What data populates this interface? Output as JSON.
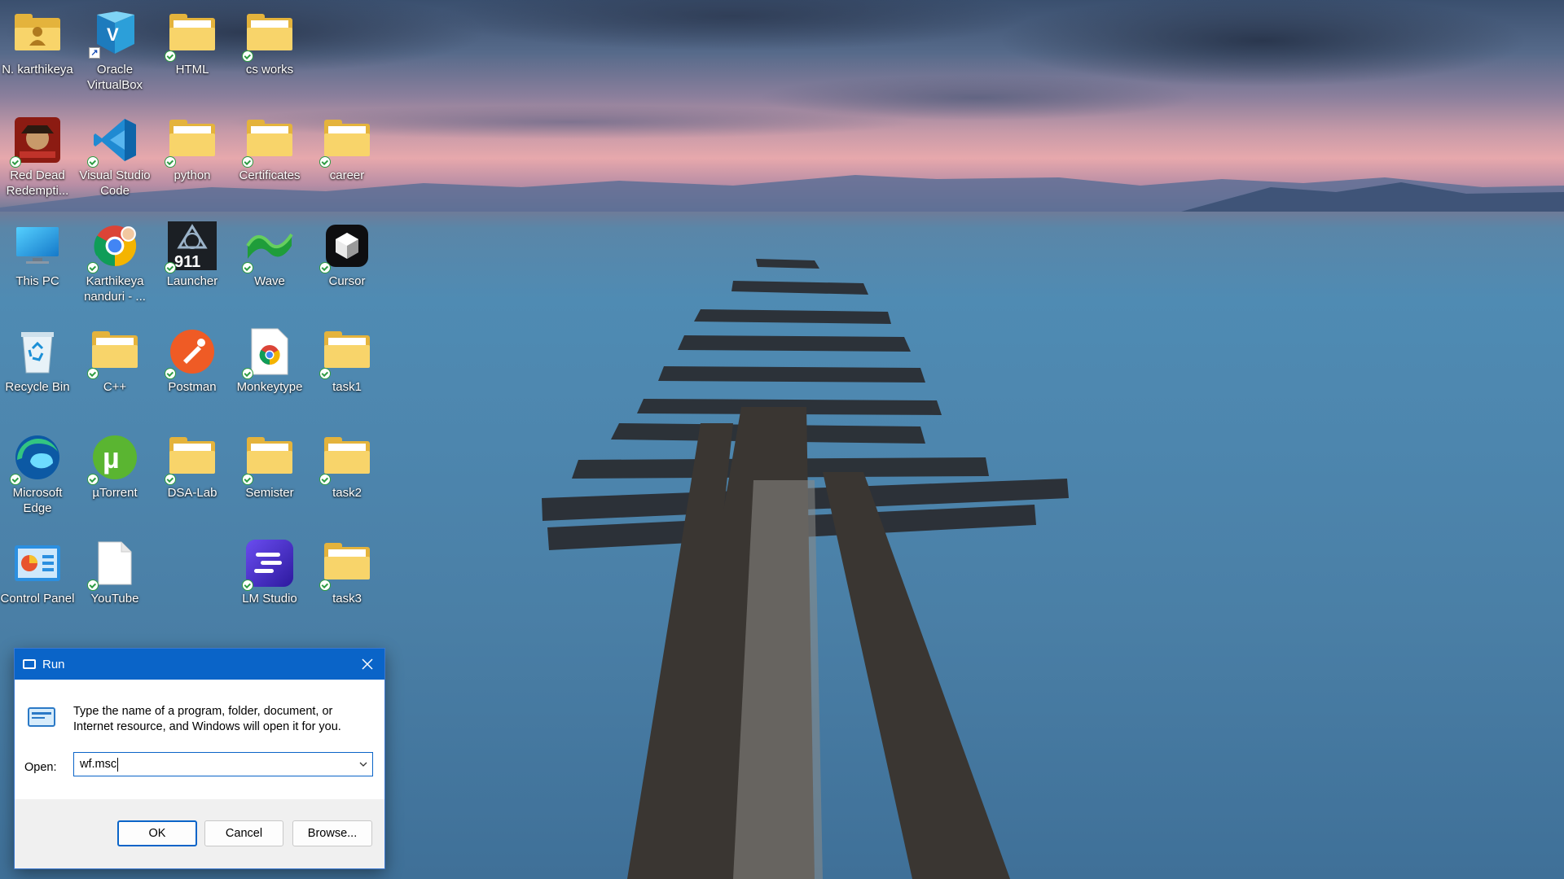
{
  "desktop": {
    "icons": [
      {
        "label": "N. karthikeya",
        "icon": "user-folder-icon"
      },
      {
        "label": "Oracle VirtualBox",
        "icon": "virtualbox-icon"
      },
      {
        "label": "HTML",
        "icon": "folder-icon"
      },
      {
        "label": "cs works",
        "icon": "folder-icon"
      },
      {
        "label": "Red Dead Redempti...",
        "icon": "red-dead-icon"
      },
      {
        "label": "Visual Studio Code",
        "icon": "vscode-icon"
      },
      {
        "label": "python",
        "icon": "folder-icon"
      },
      {
        "label": "Certificates",
        "icon": "folder-icon"
      },
      {
        "label": "career",
        "icon": "folder-icon"
      },
      {
        "label": "This PC",
        "icon": "monitor-icon"
      },
      {
        "label": "Karthikeya nanduri - ...",
        "icon": "chrome-icon"
      },
      {
        "label": "Launcher",
        "icon": "launcher-911-icon"
      },
      {
        "label": "Wave",
        "icon": "wave-icon"
      },
      {
        "label": "Cursor",
        "icon": "cursor-app-icon"
      },
      {
        "label": "Recycle Bin",
        "icon": "recycle-bin-icon"
      },
      {
        "label": "C++",
        "icon": "folder-icon"
      },
      {
        "label": "Postman",
        "icon": "postman-icon"
      },
      {
        "label": "Monkeytype",
        "icon": "chrome-file-icon"
      },
      {
        "label": "task1",
        "icon": "folder-icon"
      },
      {
        "label": "Microsoft Edge",
        "icon": "edge-icon"
      },
      {
        "label": "µTorrent",
        "icon": "utorrent-icon"
      },
      {
        "label": "DSA-Lab",
        "icon": "folder-icon"
      },
      {
        "label": "Semister",
        "icon": "folder-icon"
      },
      {
        "label": "task2",
        "icon": "folder-icon"
      },
      {
        "label": "Control Panel",
        "icon": "control-panel-icon"
      },
      {
        "label": "YouTube",
        "icon": "file-icon"
      },
      {
        "label": "LM Studio",
        "icon": "lm-studio-icon"
      },
      {
        "label": "task3",
        "icon": "folder-icon"
      }
    ]
  },
  "run_dialog": {
    "title": "Run",
    "description": "Type the name of a program, folder, document, or Internet resource, and Windows will open it for you.",
    "open_label": "Open:",
    "input_value": "wf.msc",
    "ok_label": "OK",
    "cancel_label": "Cancel",
    "browse_label": "Browse...",
    "accent_color": "#0a64c8"
  }
}
